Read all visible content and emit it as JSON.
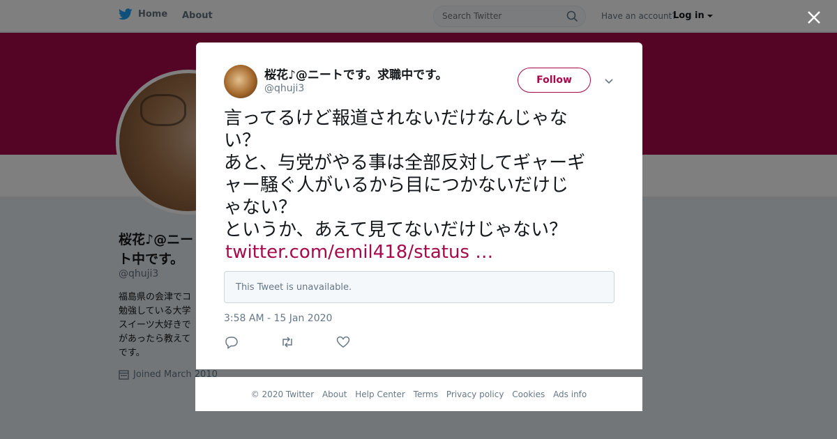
{
  "nav": {
    "home_label": "Home",
    "about_label": "About",
    "search_placeholder": "Search Twitter",
    "account_prompt": "Have an account?",
    "login_label": "Log in"
  },
  "profile": {
    "name": "桜花♪@ニート中です。",
    "handle": "@qhuji3",
    "bio_lines": [
      "福島県の会津でコ",
      "勉強している大学",
      "スイーツ大好きで",
      "があったら教えて",
      "です。"
    ],
    "joined": "Joined March 2010"
  },
  "tweet": {
    "author_name": "桜花♪@ニートです。求職中です。",
    "author_handle": "@qhuji3",
    "follow_label": "Follow",
    "text_lines": [
      "言ってるけど報道されないだけなんじゃな",
      "い？",
      "あと、与党がやる事は全部反対してギャーギ",
      "ャー騒ぐ人がいるから目につかないだけじ",
      "ゃない？",
      "というか、あえて見てないだけじゃない？"
    ],
    "link_text": "twitter.com/emil418/status …",
    "unavailable_text": "This Tweet is unavailable.",
    "timestamp": "3:58 AM - 15 Jan 2020"
  },
  "footer": {
    "links": [
      "© 2020 Twitter",
      "About",
      "Help Center",
      "Terms",
      "Privacy policy",
      "Cookies",
      "Ads info"
    ]
  },
  "colors": {
    "accent": "#a8094a",
    "twitter_blue": "#1da1f2",
    "muted": "#657786"
  },
  "icons": [
    "twitter-bird-icon",
    "search-icon",
    "caret-down-icon",
    "close-icon",
    "chevron-down-icon",
    "reply-icon",
    "retweet-icon",
    "like-icon",
    "calendar-icon"
  ]
}
